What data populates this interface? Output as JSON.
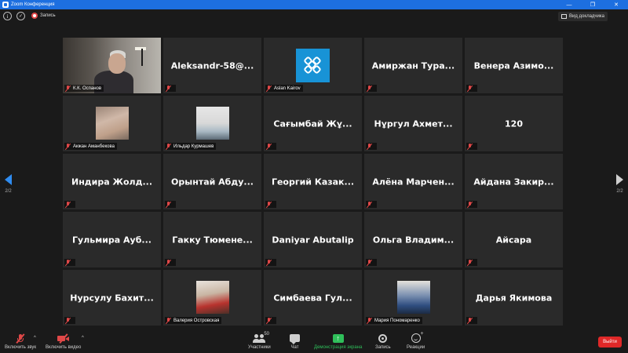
{
  "window": {
    "title": "Zoom Конференция",
    "min": "—",
    "max": "❐",
    "close": "✕"
  },
  "topbar": {
    "info_glyph": "i",
    "shield_glyph": "✓",
    "recording_label": "Запись",
    "view_label": "Вид докладчика"
  },
  "tiles": [
    {
      "name": "",
      "tag": "К.К. Оспанов",
      "kind": "video"
    },
    {
      "name": "Aleksandr-58@...",
      "tag": ""
    },
    {
      "name": "",
      "tag": "Aslan Kairov",
      "kind": "logo"
    },
    {
      "name": "Амиржан Тура...",
      "tag": ""
    },
    {
      "name": "Венера Азимо...",
      "tag": ""
    },
    {
      "name": "",
      "tag": "Акжан Аманбекова",
      "kind": "avatar1"
    },
    {
      "name": "",
      "tag": "Ильдар Курмашев",
      "kind": "avatar2"
    },
    {
      "name": "Сағымбай Жұ...",
      "tag": ""
    },
    {
      "name": "Нұргул Ахмет...",
      "tag": ""
    },
    {
      "name": "120",
      "tag": ""
    },
    {
      "name": "Индира Жолд...",
      "tag": ""
    },
    {
      "name": "Орынтай Абду...",
      "tag": ""
    },
    {
      "name": "Георгий Казак...",
      "tag": ""
    },
    {
      "name": "Алёна Марчен...",
      "tag": ""
    },
    {
      "name": "Айдана Закир...",
      "tag": ""
    },
    {
      "name": "Гульмира Ауб...",
      "tag": ""
    },
    {
      "name": "Гакку Тюмене...",
      "tag": ""
    },
    {
      "name": "Daniyar Abutalip",
      "tag": ""
    },
    {
      "name": "Ольга Владим...",
      "tag": ""
    },
    {
      "name": "Айсара",
      "tag": ""
    },
    {
      "name": "Нурсулу Бахит...",
      "tag": ""
    },
    {
      "name": "",
      "tag": "Валерия Островская",
      "kind": "avatar3"
    },
    {
      "name": "Симбаева Гул...",
      "tag": ""
    },
    {
      "name": "",
      "tag": "Мария Пономаренко",
      "kind": "avatar4"
    },
    {
      "name": "Дарья Якимова",
      "tag": ""
    }
  ],
  "nav": {
    "left_page": "2/2",
    "right_page": "2/2"
  },
  "bottombar": {
    "audio_label": "Включить звук",
    "video_label": "Включить видео",
    "participants_label": "Участники",
    "participants_count": "50",
    "chat_label": "Чат",
    "share_label": "Демонстрация экрана",
    "share_glyph": "↑",
    "record_label": "Запись",
    "reactions_label": "Реакции",
    "reaction_plus": "+",
    "leave_label": "Выйти",
    "caret": "^"
  },
  "colors": {
    "titlebar": "#1d6fe0",
    "muted": "#e04848",
    "share": "#2fbf5a",
    "leave": "#e02828",
    "tile": "#2a2a2a",
    "background": "#1a1a1a"
  }
}
